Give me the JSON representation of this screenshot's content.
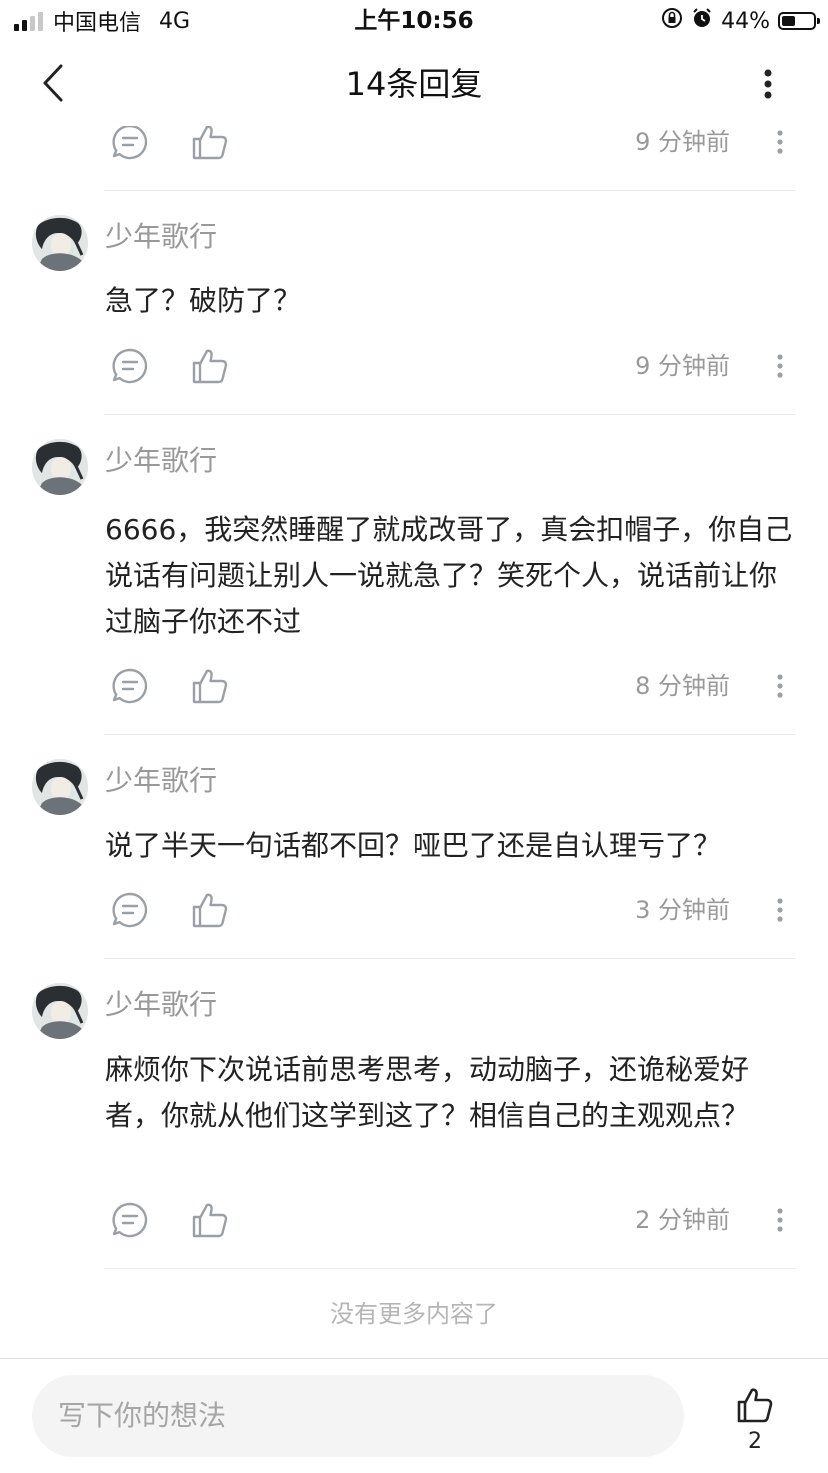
{
  "status_bar": {
    "carrier": "中国电信",
    "network": "4G",
    "time": "上午10:56",
    "battery": "44%",
    "battery_level": 0.44
  },
  "nav": {
    "title": "14条回复",
    "back_icon": "chevron-left-icon",
    "more_icon": "more-vertical-icon"
  },
  "top_partial": {
    "time": "9 分钟前"
  },
  "comments": [
    {
      "author": "少年歌行",
      "text": "急了？破防了？",
      "time": "9 分钟前"
    },
    {
      "author": "少年歌行",
      "text": "6666，我突然睡醒了就成改哥了，真会扣帽子，你自己说话有问题让别人一说就急了？笑死个人，说话前让你过脑子你还不过",
      "time": "8 分钟前"
    },
    {
      "author": "少年歌行",
      "text": "说了半天一句话都不回？哑巴了还是自认理亏了？",
      "time": "3 分钟前"
    },
    {
      "author": "少年歌行",
      "text": "麻烦你下次说话前思考思考，动动脑子，还诡秘爱好者，你就从他们这学到这了？相信自己的主观观点？",
      "time": "2 分钟前"
    }
  ],
  "footer_text": "没有更多内容了",
  "bottom_bar": {
    "input_placeholder": "写下你的想法",
    "like_count": "2"
  },
  "icons": {
    "reply": "comment-bubble-icon",
    "like": "thumbs-up-icon",
    "more": "more-vertical-icon"
  }
}
